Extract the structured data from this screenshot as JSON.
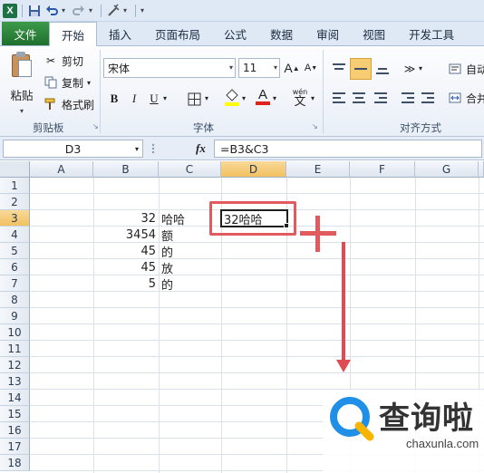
{
  "qat": {
    "app_icon": "excel-icon",
    "app_letter": "X",
    "icons": [
      "save-icon",
      "undo-icon",
      "redo-icon",
      "customize-icon"
    ]
  },
  "tabs": [
    "文件",
    "开始",
    "插入",
    "页面布局",
    "公式",
    "数据",
    "审阅",
    "视图",
    "开发工具"
  ],
  "active_tab": "开始",
  "ribbon": {
    "clipboard": {
      "paste": "粘贴",
      "cut": "剪切",
      "copy": "复制",
      "format_painter": "格式刷",
      "label": "剪贴板"
    },
    "font": {
      "name": "宋体",
      "size": "11",
      "grow": "A",
      "shrink": "A",
      "bold": "B",
      "italic": "I",
      "underline": "U",
      "font_color_letter": "A",
      "wen": "wén",
      "wen_char": "文",
      "label": "字体"
    },
    "alignment": {
      "wrap_label": "自动",
      "merge_label": "合并",
      "label": "对齐方式"
    }
  },
  "formula_bar": {
    "name_box": "D3",
    "fx": "fx",
    "formula": "=B3&C3"
  },
  "sheet": {
    "columns": [
      "A",
      "B",
      "C",
      "D",
      "E",
      "F",
      "G"
    ],
    "selected_column": "D",
    "rows": [
      "1",
      "2",
      "3",
      "4",
      "5",
      "6",
      "7",
      "8",
      "9",
      "10",
      "11",
      "12",
      "13",
      "14",
      "15",
      "16",
      "17",
      "18"
    ],
    "selected_row": "3",
    "col_b": [
      "32",
      "3454",
      "45",
      "45",
      "5"
    ],
    "col_c": [
      "哈哈",
      "额",
      "的",
      "放",
      "的"
    ],
    "d3": "32哈哈"
  },
  "annotations": {
    "highlight_color": "#e05a5e",
    "arrow_color": "#e04a52"
  },
  "watermark": {
    "title": "查询啦",
    "url": "chaxunla.com"
  },
  "colors": {
    "file_tab": "#2e7d32",
    "selected_header": "#f1c15f",
    "logo_blue": "#1f8fe8",
    "logo_yellow": "#f7b500"
  }
}
